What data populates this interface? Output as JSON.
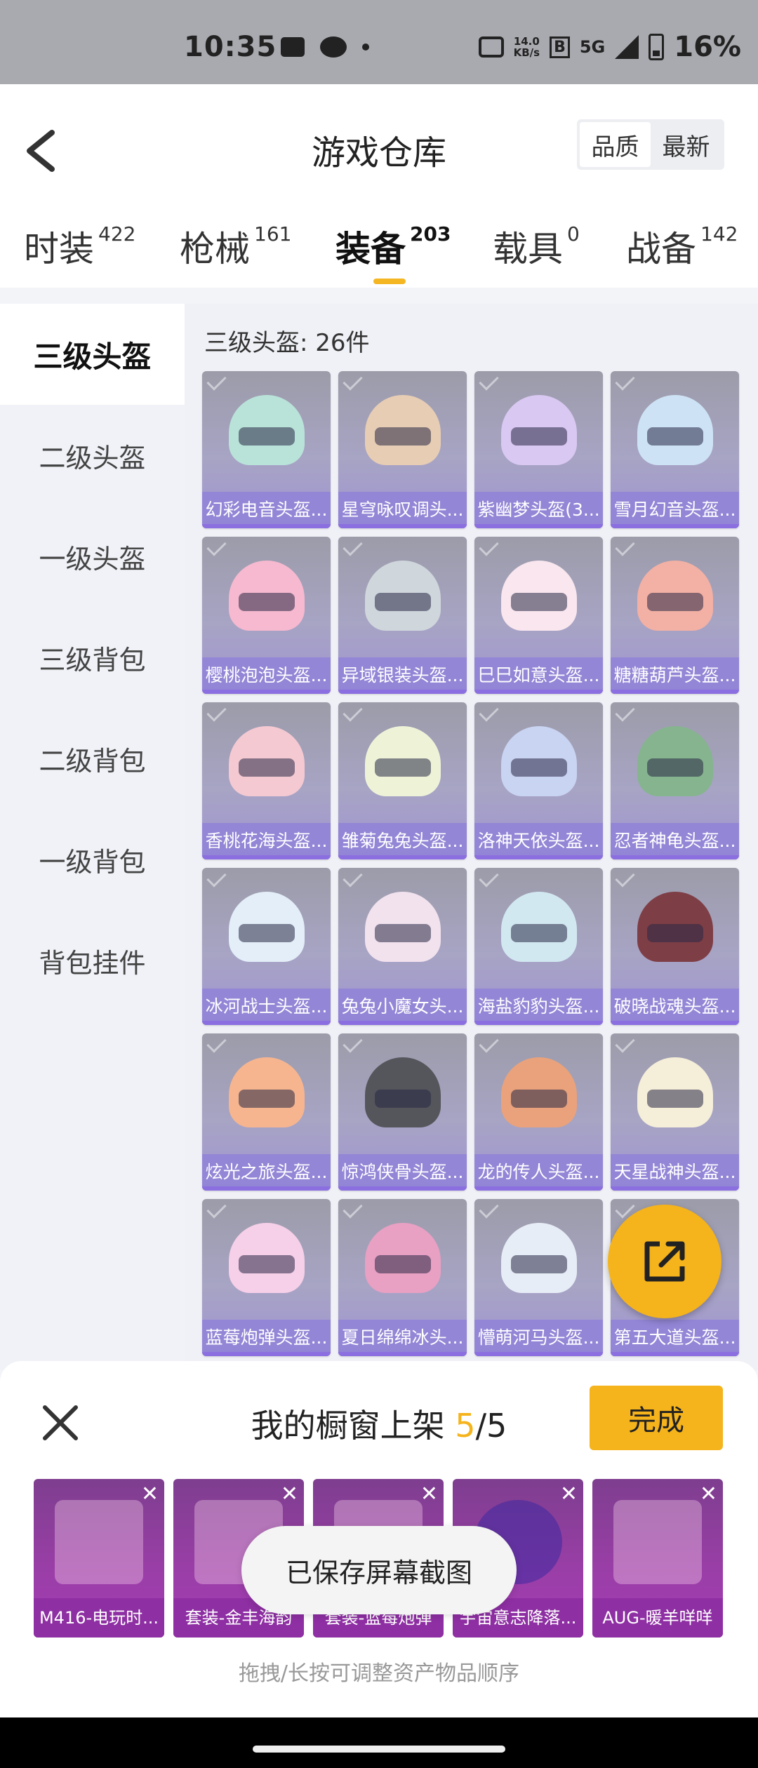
{
  "status_bar": {
    "time": "10:35",
    "speed_top": "14.0",
    "speed_unit": "KB/s",
    "network": "5G",
    "battery": "16%"
  },
  "header": {
    "title": "游戏仓库",
    "sort": [
      "品质",
      "最新"
    ],
    "active_sort": "品质",
    "tabs": [
      {
        "label": "时装",
        "count": "422"
      },
      {
        "label": "枪械",
        "count": "161"
      },
      {
        "label": "装备",
        "count": "203"
      },
      {
        "label": "载具",
        "count": "0"
      },
      {
        "label": "战备",
        "count": "142"
      }
    ],
    "active_tab": "装备"
  },
  "sidebar": {
    "items": [
      "三级头盔",
      "二级头盔",
      "一级头盔",
      "三级背包",
      "二级背包",
      "一级背包",
      "背包挂件"
    ],
    "active": "三级头盔"
  },
  "main": {
    "section_title": "三级头盔: 26件",
    "items": [
      "幻彩电音头盔...",
      "星穹咏叹调头...",
      "紫幽梦头盔(3...",
      "雪月幻音头盔...",
      "樱桃泡泡头盔...",
      "异域银装头盔...",
      "巳巳如意头盔...",
      "糖糖葫芦头盔...",
      "香桃花海头盔...",
      "雏菊兔兔头盔...",
      "洛神天依头盔...",
      "忍者神龟头盔...",
      "冰河战士头盔...",
      "兔兔小魔女头...",
      "海盐豹豹头盔...",
      "破晓战魂头盔...",
      "炫光之旅头盔...",
      "惊鸿侠骨头盔...",
      "龙的传人头盔...",
      "天星战神头盔...",
      "蓝莓炮弹头盔...",
      "夏日绵绵冰头...",
      "懵萌河马头盔...",
      "第五大道头盔..."
    ],
    "helmet_colors": [
      "#b9e3d9",
      "#e7cdb4",
      "#d9c8f2",
      "#cde3f5",
      "#f6b9cf",
      "#cfd6dc",
      "#f9e6ee",
      "#f3b0a4",
      "#f4c9d2",
      "#eef3d8",
      "#c9d3f2",
      "#86b48f",
      "#e3eef8",
      "#f2e2ee",
      "#d2e8f1",
      "#7e3e46",
      "#f6b58f",
      "#55565c",
      "#e9a27b",
      "#f5eed9",
      "#f6cfe8",
      "#e8a0c3",
      "#e7edf6",
      "#c9c7d3"
    ]
  },
  "sheet": {
    "title_prefix": "我的橱窗上架",
    "count_current": "5",
    "count_total": "/5",
    "done_label": "完成",
    "showcase": [
      "M416-电玩时...",
      "套装-金丰海韵",
      "套装-蓝莓炮弹",
      "宇宙意志降落...",
      "AUG-暖羊咩咩"
    ],
    "hint": "拖拽/长按可调整资产物品顺序"
  },
  "toast": "已保存屏幕截图",
  "colors": {
    "accent": "#f5b31c",
    "card_purple": "#a195d3",
    "showcase_magenta": "#9b3ea8"
  }
}
